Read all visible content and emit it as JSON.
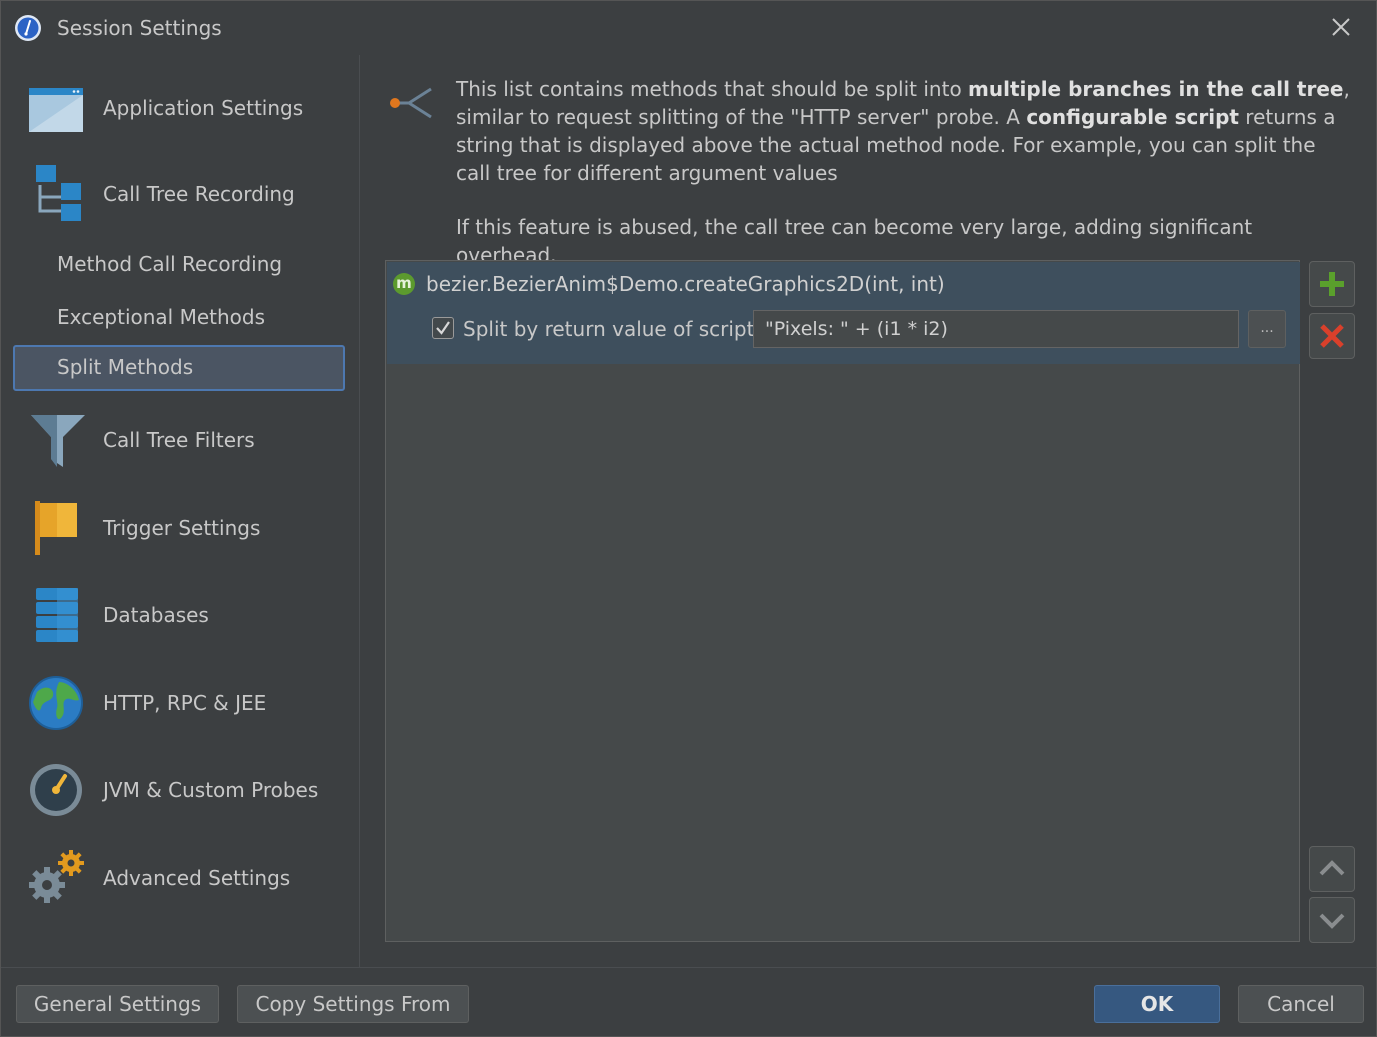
{
  "window": {
    "title": "Session Settings",
    "app_icon": "jprofiler-icon",
    "close_icon": "close-icon"
  },
  "sidebar": {
    "items": [
      {
        "label": "Application Settings",
        "icon": "application-window-icon"
      },
      {
        "label": "Call Tree Recording",
        "icon": "call-tree-icon"
      },
      {
        "label": "Method Call Recording"
      },
      {
        "label": "Exceptional Methods"
      },
      {
        "label": "Split Methods",
        "selected": true
      },
      {
        "label": "Call Tree Filters",
        "icon": "funnel-icon"
      },
      {
        "label": "Trigger Settings",
        "icon": "flag-icon"
      },
      {
        "label": "Databases",
        "icon": "database-icon"
      },
      {
        "label": "HTTP, RPC & JEE",
        "icon": "globe-icon"
      },
      {
        "label": "JVM & Custom Probes",
        "icon": "gauge-icon"
      },
      {
        "label": "Advanced Settings",
        "icon": "gears-icon"
      }
    ]
  },
  "main": {
    "intro_icon": "split-arrow-icon",
    "description": {
      "p1_a": "This list contains methods that should be split into ",
      "p1_b": "multiple branches in the call tree",
      "p1_c": ", similar to request splitting of the \"HTTP server\" probe. A ",
      "p1_d": "configurable script",
      "p1_e": " returns a string that is displayed above the actual method node. For example, you can split the call tree for different argument values",
      "p2": "If this feature is abused, the call tree can become very large, adding significant overhead."
    },
    "list": {
      "items": [
        {
          "badge": "m",
          "method": "bezier.BezierAnim$Demo.createGraphics2D(int, int)",
          "split_checked": true,
          "split_label": "Split by return value of script:",
          "script": "\"Pixels: \" + (i1 * i2)",
          "ellipsis_label": "..."
        }
      ]
    },
    "side_buttons": {
      "add_icon": "plus-icon",
      "remove_icon": "delete-icon",
      "up_icon": "chevron-up-icon",
      "down_icon": "chevron-down-icon"
    }
  },
  "footer": {
    "general_settings": "General Settings",
    "copy_settings_from": "Copy Settings From",
    "ok": "OK",
    "cancel": "Cancel"
  },
  "colors": {
    "background": "#3c3f41",
    "selection": "#3e4f5d",
    "accent": "#365880",
    "add_green": "#5aa02c",
    "remove_red": "#d9402b"
  }
}
